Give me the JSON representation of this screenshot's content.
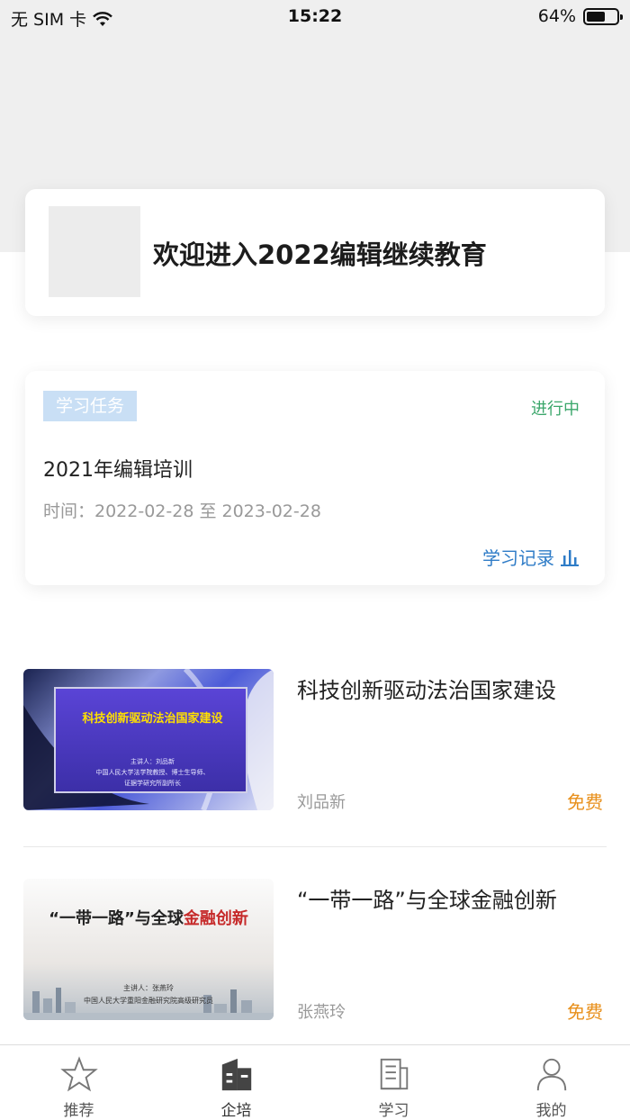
{
  "status_bar": {
    "carrier": "无 SIM 卡",
    "time": "15:22",
    "battery_text": "64%",
    "battery_level": 0.64
  },
  "welcome": {
    "text": "欢迎进入2022编辑继续教育"
  },
  "task": {
    "tag": "学习任务",
    "status": "进行中",
    "title": "2021年编辑培训",
    "time": "时间：2022-02-28 至 2023-02-28",
    "record_link": "学习记录"
  },
  "courses": [
    {
      "title": "科技创新驱动法治国家建设",
      "author": "刘品新",
      "price": "免费",
      "thumb_title": "科技创新驱动法治国家建设",
      "thumb_line1": "主讲人：刘品新",
      "thumb_line2": "中国人民大学法学院教授、博士生导师、",
      "thumb_line3": "证据学研究所副所长"
    },
    {
      "title": "“一带一路”与全球金融创新",
      "author": "张燕玲",
      "price": "免费",
      "thumb_title_a": "“一带一路”与全球",
      "thumb_title_b": "金融创新",
      "thumb_line1": "主讲人：张燕玲",
      "thumb_line2": "中国人民大学重阳金融研究院高级研究员"
    }
  ],
  "nav": [
    {
      "label": "推荐",
      "icon": "star-icon"
    },
    {
      "label": "企培",
      "icon": "building-icon"
    },
    {
      "label": "学习",
      "icon": "book-icon"
    },
    {
      "label": "我的",
      "icon": "user-icon"
    }
  ],
  "colors": {
    "accent_green": "#3aa66a",
    "link_blue": "#2f7cc7",
    "price_orange": "#e8901c",
    "tag_blue": "#c9dff5"
  }
}
